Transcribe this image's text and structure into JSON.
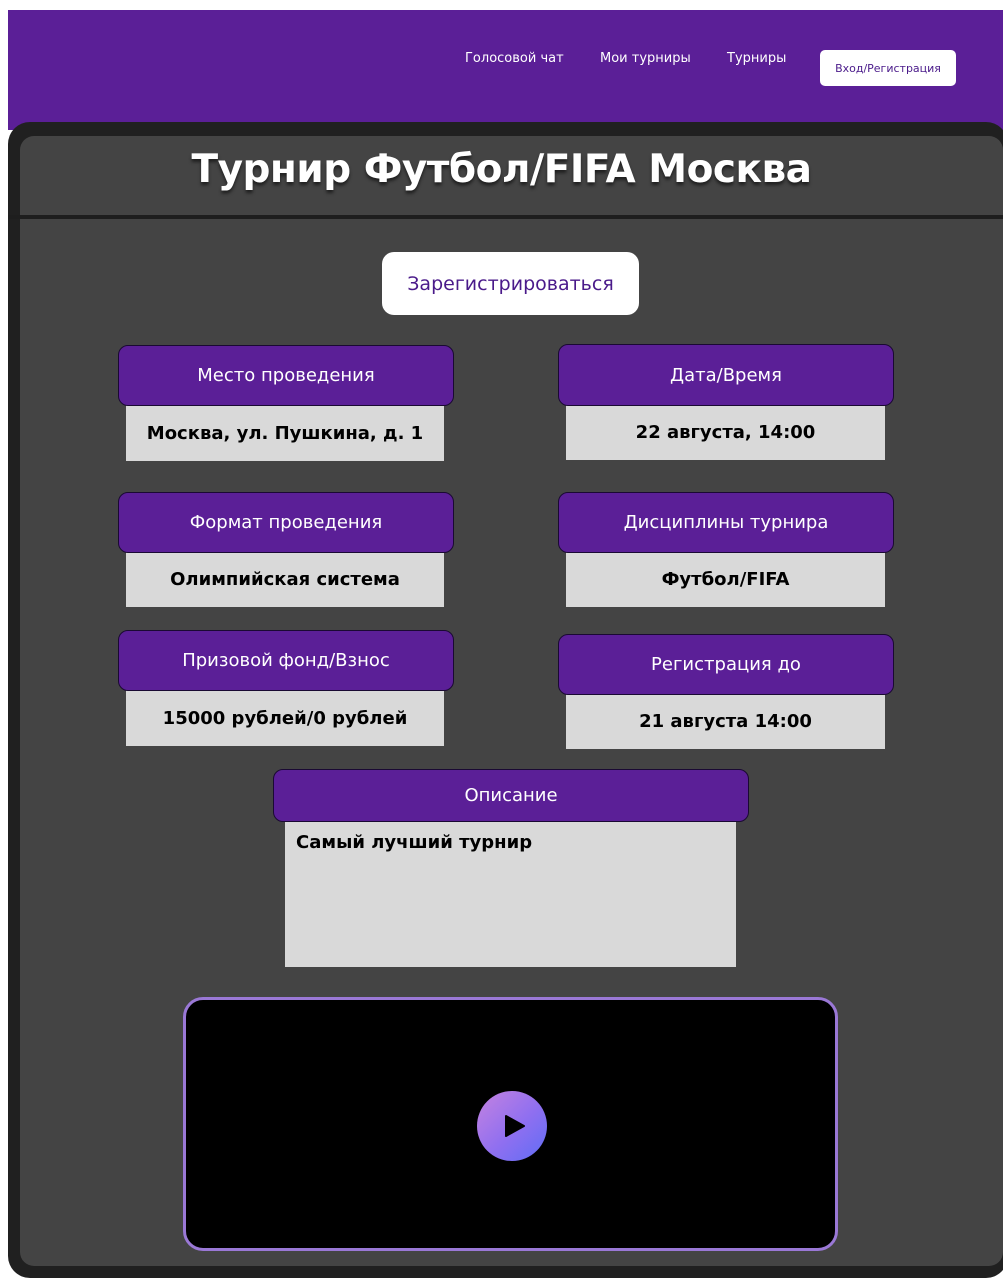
{
  "nav": {
    "voice_chat": "Голосовой чат",
    "my_tournaments": "Мои турниры",
    "tournaments": "Турниры",
    "login": "Вход/Регистрация"
  },
  "page": {
    "title": "Турнир Футбол/FIFA Москва",
    "register_label": "Зарегистрироваться"
  },
  "info": {
    "venue": {
      "label": "Место проведения",
      "value": "Москва, ул. Пушкина, д. 1"
    },
    "datetime": {
      "label": "Дата/Время",
      "value": "22 августа, 14:00"
    },
    "format": {
      "label": "Формат проведения",
      "value": "Олимпийская система"
    },
    "disciplines": {
      "label": "Дисциплины турнира",
      "value": "Футбол/FIFA"
    },
    "prize": {
      "label": "Призовой фонд/Взнос",
      "value": "15000 рублей/0 рублей"
    },
    "registration_deadline": {
      "label": "Регистрация до",
      "value": "21 августа 14:00"
    },
    "description": {
      "label": "Описание",
      "value": "Самый лучший турнир"
    }
  },
  "video": {
    "play_icon": "play-icon"
  },
  "colors": {
    "brand_purple": "#5b1f97",
    "panel_dark": "#444444",
    "card_body": "#d9d9d9",
    "video_border": "#9a78d6"
  }
}
